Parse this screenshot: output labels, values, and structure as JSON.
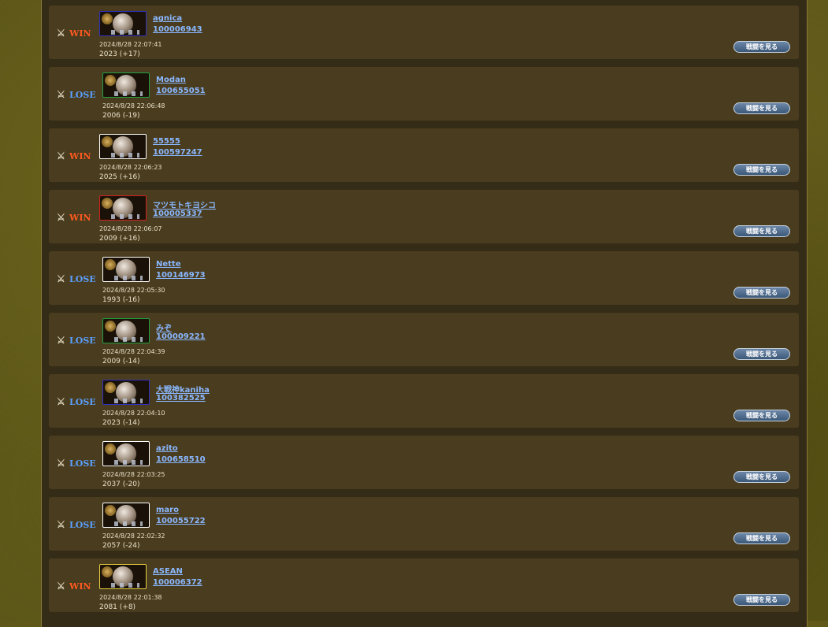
{
  "colors": {
    "win": "#ff5a20",
    "lose": "#5aa0ff",
    "link": "#8ab8ff",
    "row_bg": "#4a3c1e"
  },
  "battles": [
    {
      "result": "WIN",
      "frame": "#3030c0",
      "name": "agnica",
      "user_id": "100006943",
      "timestamp": "2024/8/28 22:07:41",
      "rating": "2023 (+17)",
      "button": "戦闘を見る"
    },
    {
      "result": "LOSE",
      "frame": "#20a040",
      "name": "Modan",
      "user_id": "100655051",
      "timestamp": "2024/8/28 22:06:48",
      "rating": "2006 (-19)",
      "button": "戦闘を見る"
    },
    {
      "result": "WIN",
      "frame": "#ffffff",
      "name": "55555",
      "user_id": "100597247",
      "timestamp": "2024/8/28 22:06:23",
      "rating": "2025 (+16)",
      "button": "戦闘を見る"
    },
    {
      "result": "WIN",
      "frame": "#d02020",
      "name": "マツモトキヨシコ",
      "user_id": "100005337",
      "timestamp": "2024/8/28 22:06:07",
      "rating": "2009 (+16)",
      "button": "戦闘を見る"
    },
    {
      "result": "LOSE",
      "frame": "#ffffff",
      "name": "Nette",
      "user_id": "100146973",
      "timestamp": "2024/8/28 22:05:30",
      "rating": "1993 (-16)",
      "button": "戦闘を見る"
    },
    {
      "result": "LOSE",
      "frame": "#20a040",
      "name": "みぞ",
      "user_id": "100009221",
      "timestamp": "2024/8/28 22:04:39",
      "rating": "2009 (-14)",
      "button": "戦闘を見る"
    },
    {
      "result": "LOSE",
      "frame": "#3030c0",
      "name": "大戦神kaniha",
      "user_id": "100382525",
      "timestamp": "2024/8/28 22:04:10",
      "rating": "2023 (-14)",
      "button": "戦闘を見る"
    },
    {
      "result": "LOSE",
      "frame": "#ffffff",
      "name": "azito",
      "user_id": "100658510",
      "timestamp": "2024/8/28 22:03:25",
      "rating": "2037 (-20)",
      "button": "戦闘を見る"
    },
    {
      "result": "LOSE",
      "frame": "#ffffff",
      "name": "maro",
      "user_id": "100055722",
      "timestamp": "2024/8/28 22:02:32",
      "rating": "2057 (-24)",
      "button": "戦闘を見る"
    },
    {
      "result": "WIN",
      "frame": "#e8d040",
      "name": "ASEAN",
      "user_id": "100006372",
      "timestamp": "2024/8/28 22:01:38",
      "rating": "2081 (+8)",
      "button": "戦闘を見る"
    }
  ]
}
